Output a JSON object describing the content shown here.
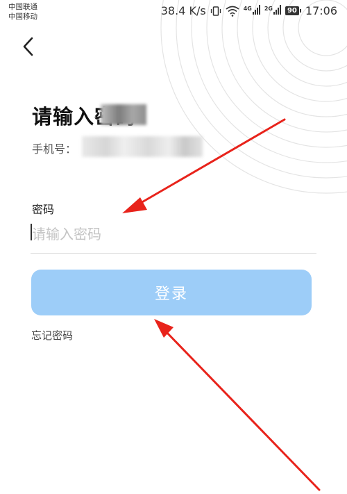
{
  "status_bar": {
    "carrier_1": "中国联通",
    "carrier_2": "中国移动",
    "net_speed": "38.4 K/s",
    "sim1_net": "4G",
    "sim2_net": "2G",
    "battery": "90",
    "time": "17:06"
  },
  "page": {
    "title": "请输入密码",
    "phone_label": "手机号：",
    "password_label": "密码",
    "password_placeholder": "请输入密码",
    "password_value": "",
    "login_button": "登录",
    "forgot_password": "忘记密码"
  },
  "colors": {
    "button_bg": "#9dcdf8",
    "annotation_arrow": "#e8231b"
  }
}
